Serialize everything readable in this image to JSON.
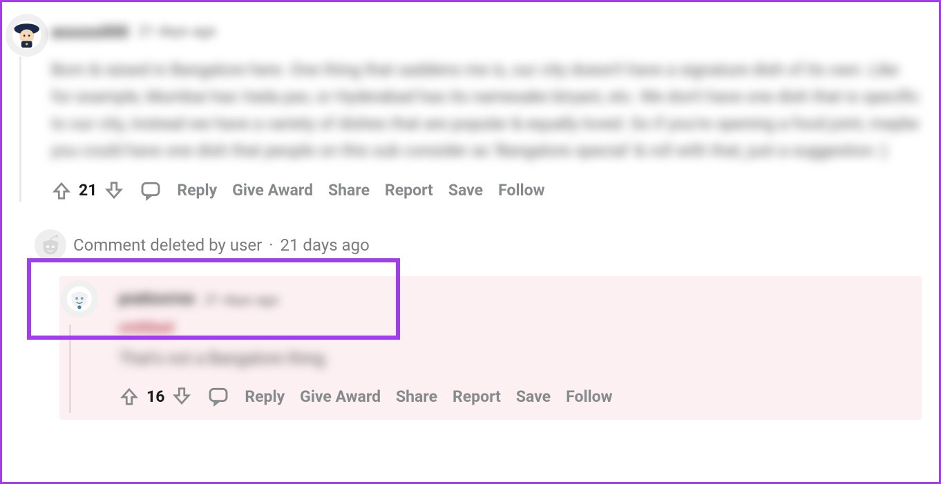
{
  "comment1": {
    "username_blur": "assoss000",
    "timestamp_blur": "21 days ago",
    "body_blur": "Born & raised in Bangalore here. One thing that saddens me is, our city doesn't have a signature dish of its own. Like for example, Mumbai has Vada pav, or Hyderabad has its namesake biryani, etc. We don't have one dish that is specific to our city, instead we have a variety of dishes that are popular & equally loved. So if you're opening a food joint, maybe you could have one dish that people on this sub consider as 'Bangalore special' & roll with that, just a suggestion :)",
    "score": "21",
    "reply": "Reply",
    "award": "Give Award",
    "share": "Share",
    "report": "Report",
    "save": "Save",
    "follow": "Follow"
  },
  "deleted": {
    "label": "Comment deleted by user",
    "sep": "·",
    "timestamp": "21 days ago"
  },
  "comment2": {
    "username_blur": "prattsvrrnn",
    "timestamp_blur": "21 days ago",
    "tag_blur": "smthbad",
    "body_blur": "That's not a Bangalore thing.",
    "score": "16",
    "reply": "Reply",
    "award": "Give Award",
    "share": "Share",
    "report": "Report",
    "save": "Save",
    "follow": "Follow"
  }
}
